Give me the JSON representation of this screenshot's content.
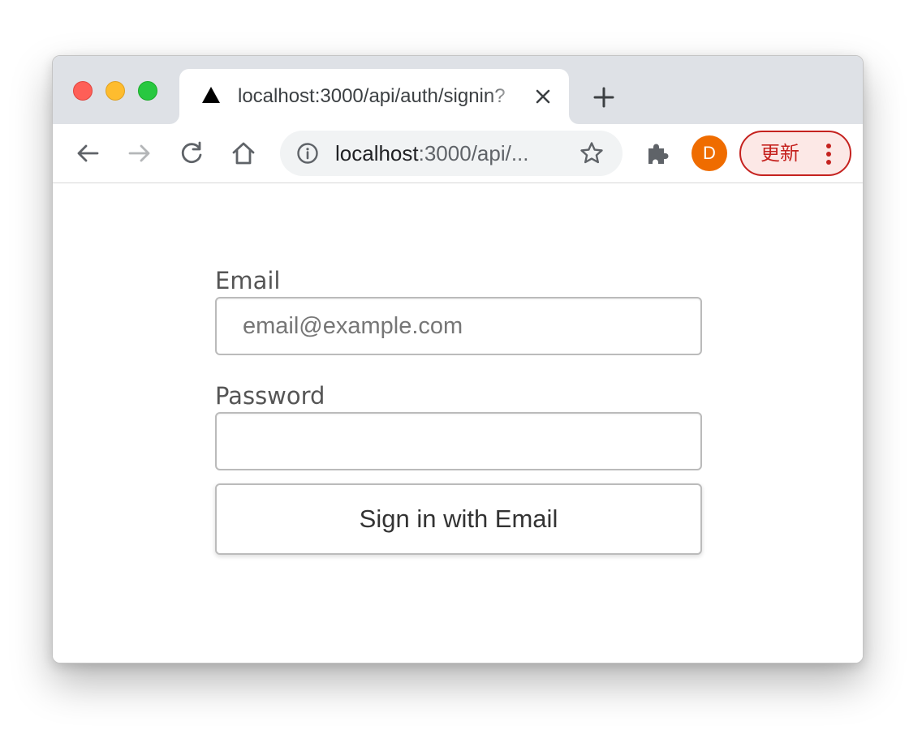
{
  "tab": {
    "title": "localhost:3000/api/auth/signin?",
    "favicon": "triangle-icon"
  },
  "toolbar": {
    "url_host": "localhost",
    "url_rest": ":3000/api/...",
    "profile_initial": "D",
    "profile_color": "#ef6c00",
    "update_label": "更新",
    "update_color": "#c5221f"
  },
  "form": {
    "email_label": "Email",
    "email_placeholder": "email@example.com",
    "email_value": "",
    "password_label": "Password",
    "password_value": "",
    "submit_label": "Sign in with Email"
  }
}
